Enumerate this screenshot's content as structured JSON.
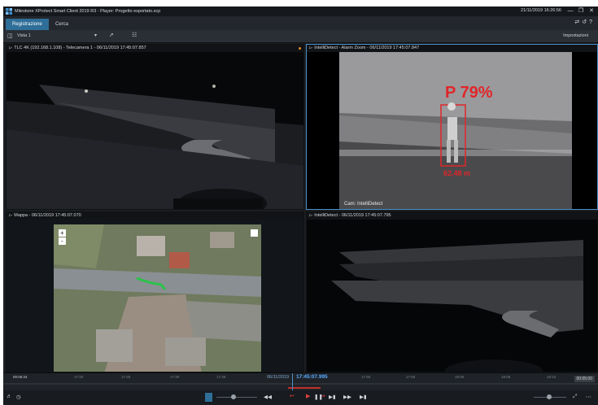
{
  "window": {
    "title": "Milestone XProtect Smart Client 2019 R3 - Player: Progetto esportato.scp",
    "clock": "21/11/2019 16:26:56",
    "minimize_icon": "minimize-icon",
    "restore_icon": "restore-icon",
    "close_icon": "close-icon"
  },
  "tabs": [
    {
      "label": "Registrazione",
      "active": true
    },
    {
      "label": "Cerca",
      "active": false
    }
  ],
  "view_bar": {
    "view_name": "Vista 1",
    "settings_label": "Impostazioni"
  },
  "cameras": [
    {
      "header": "TLC 4K (192.168.1.108) - Telecamera 1 - 06/11/2019 17:45:07.857"
    },
    {
      "header": "IntelliDetect - Alarm Zoom - 06/11/2019 17:45:07.847",
      "confidence": "P 79%",
      "distance": "62,48 m",
      "cam_label": "Cam: IntelliDetect"
    },
    {
      "header": "Mappa - 06/11/2019 17:45:07.070"
    },
    {
      "header": "IntelliDetect - 06/11/2019 17:45:07.795"
    }
  ],
  "timeline": {
    "zoom_label": "00:06:24",
    "ticks": [
      "17:20",
      "17:25",
      "17:30",
      "17:35",
      "17:40",
      "17:50",
      "17:55",
      "18:00",
      "18:05",
      "18:10"
    ],
    "date": "06/11/2019",
    "current_time": "17:45:07.995",
    "zoom_button": "00:05:00"
  },
  "colors": {
    "accent": "#2e6e98",
    "alarm": "#e0262a",
    "playhead": "#4a90c8"
  }
}
